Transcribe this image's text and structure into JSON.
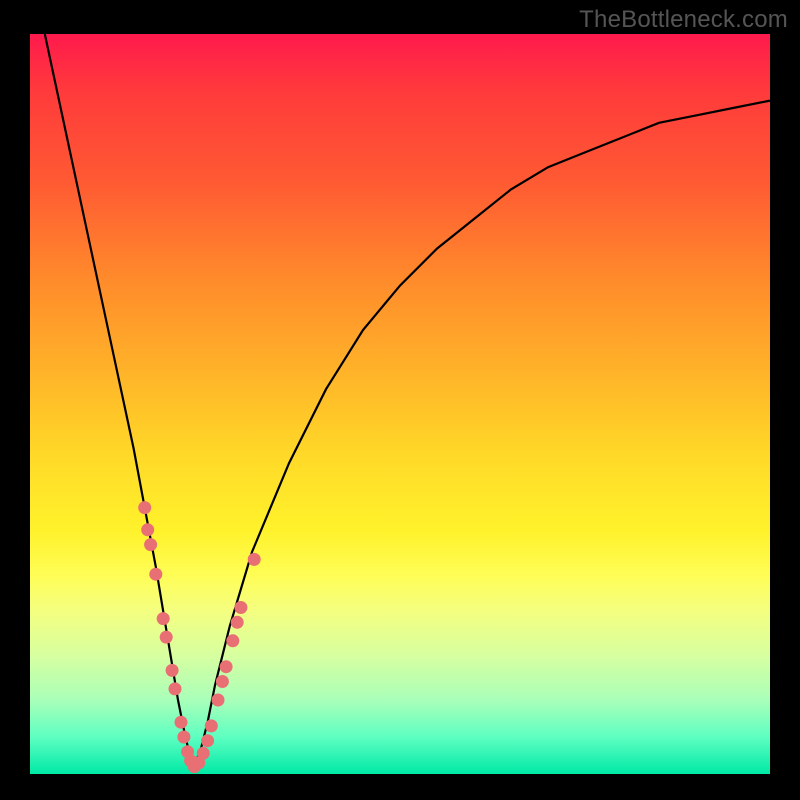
{
  "watermark_text": "TheBottleneck.com",
  "colors": {
    "gradient_top": "#ff1a4d",
    "gradient_bottom": "#00e9a6",
    "curve_stroke": "#000000",
    "marker_fill": "#e86f73",
    "frame_bg": "#000000"
  },
  "chart_data": {
    "type": "line",
    "title": "",
    "xlabel": "",
    "ylabel": "",
    "xlim": [
      0,
      100
    ],
    "ylim": [
      0,
      100
    ],
    "grid": false,
    "legend": false,
    "description": "V-shaped bottleneck curve; low y = good (green), high y = bad (red); minimum near x ≈ 22",
    "series": [
      {
        "name": "bottleneck-curve",
        "x": [
          2,
          5,
          8,
          11,
          14,
          17,
          19,
          20,
          21,
          22,
          23,
          24,
          25,
          27,
          30,
          35,
          40,
          45,
          50,
          55,
          60,
          65,
          70,
          75,
          80,
          85,
          90,
          95,
          100
        ],
        "y": [
          100,
          86,
          72,
          58,
          44,
          28,
          16,
          10,
          5,
          1,
          3,
          7,
          12,
          20,
          30,
          42,
          52,
          60,
          66,
          71,
          75,
          79,
          82,
          84,
          86,
          88,
          89,
          90,
          91
        ]
      }
    ],
    "markers": [
      {
        "x": 15.5,
        "y": 36
      },
      {
        "x": 15.9,
        "y": 33
      },
      {
        "x": 16.3,
        "y": 31
      },
      {
        "x": 17.0,
        "y": 27
      },
      {
        "x": 18.0,
        "y": 21
      },
      {
        "x": 18.4,
        "y": 18.5
      },
      {
        "x": 19.2,
        "y": 14
      },
      {
        "x": 19.6,
        "y": 11.5
      },
      {
        "x": 20.4,
        "y": 7
      },
      {
        "x": 20.8,
        "y": 5
      },
      {
        "x": 21.3,
        "y": 3
      },
      {
        "x": 21.7,
        "y": 1.8
      },
      {
        "x": 22.2,
        "y": 1
      },
      {
        "x": 22.8,
        "y": 1.5
      },
      {
        "x": 23.4,
        "y": 2.8
      },
      {
        "x": 24.0,
        "y": 4.5
      },
      {
        "x": 24.5,
        "y": 6.5
      },
      {
        "x": 25.4,
        "y": 10
      },
      {
        "x": 26.0,
        "y": 12.5
      },
      {
        "x": 26.5,
        "y": 14.5
      },
      {
        "x": 27.4,
        "y": 18
      },
      {
        "x": 28.0,
        "y": 20.5
      },
      {
        "x": 28.5,
        "y": 22.5
      },
      {
        "x": 30.3,
        "y": 29
      }
    ]
  }
}
